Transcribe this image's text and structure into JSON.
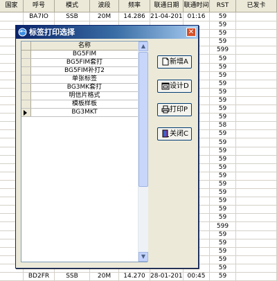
{
  "grid": {
    "columns": [
      "国家",
      "呼号",
      "模式",
      "波段",
      "频率",
      "联通日期",
      "联通时间",
      "RST",
      "已发卡"
    ],
    "rows": [
      [
        "",
        "BA7IO",
        "SSB",
        "20M",
        "14.286",
        "21-04-2012",
        "01:16",
        "59",
        ""
      ],
      [
        "",
        "",
        "",
        "",
        "",
        "",
        "",
        "59",
        ""
      ],
      [
        "",
        "",
        "",
        "",
        "",
        "",
        "",
        "59",
        ""
      ],
      [
        "",
        "",
        "",
        "",
        "",
        "",
        "",
        "59",
        ""
      ],
      [
        "",
        "",
        "",
        "",
        "",
        "",
        "",
        "599",
        ""
      ],
      [
        "",
        "",
        "",
        "",
        "",
        "",
        "",
        "59",
        ""
      ],
      [
        "",
        "",
        "",
        "",
        "",
        "",
        "",
        "59",
        ""
      ],
      [
        "",
        "",
        "",
        "",
        "",
        "",
        "",
        "59",
        ""
      ],
      [
        "",
        "",
        "",
        "",
        "",
        "",
        "",
        "59",
        ""
      ],
      [
        "",
        "",
        "",
        "",
        "",
        "",
        "",
        "59",
        ""
      ],
      [
        "",
        "",
        "",
        "",
        "",
        "",
        "",
        "59",
        ""
      ],
      [
        "",
        "",
        "",
        "",
        "",
        "",
        "",
        "59",
        ""
      ],
      [
        "",
        "",
        "",
        "",
        "",
        "",
        "",
        "59",
        ""
      ],
      [
        "",
        "",
        "",
        "",
        "",
        "",
        "",
        "58",
        ""
      ],
      [
        "",
        "",
        "",
        "",
        "",
        "",
        "",
        "59",
        ""
      ],
      [
        "",
        "",
        "",
        "",
        "",
        "",
        "",
        "59",
        ""
      ],
      [
        "",
        "",
        "",
        "",
        "",
        "",
        "",
        "59",
        ""
      ],
      [
        "",
        "",
        "",
        "",
        "",
        "",
        "",
        "59",
        ""
      ],
      [
        "",
        "",
        "",
        "",
        "",
        "",
        "",
        "59",
        ""
      ],
      [
        "",
        "",
        "",
        "",
        "",
        "",
        "",
        "59",
        ""
      ],
      [
        "",
        "",
        "",
        "",
        "",
        "",
        "",
        "59",
        ""
      ],
      [
        "",
        "",
        "",
        "",
        "",
        "",
        "",
        "59",
        ""
      ],
      [
        "",
        "",
        "",
        "",
        "",
        "",
        "",
        "59",
        ""
      ],
      [
        "",
        "",
        "",
        "",
        "",
        "",
        "",
        "59",
        ""
      ],
      [
        "",
        "",
        "",
        "",
        "",
        "",
        "",
        "59",
        ""
      ],
      [
        "",
        "",
        "",
        "",
        "",
        "",
        "",
        "599",
        ""
      ],
      [
        "",
        "",
        "",
        "",
        "",
        "",
        "",
        "59",
        ""
      ],
      [
        "",
        "",
        "",
        "",
        "",
        "",
        "",
        "59",
        ""
      ],
      [
        "",
        "",
        "",
        "",
        "",
        "",
        "",
        "59",
        ""
      ],
      [
        "",
        "",
        "",
        "",
        "",
        "",
        "",
        "59",
        ""
      ],
      [
        "",
        "",
        "",
        "",
        "",
        "",
        "",
        "59",
        ""
      ],
      [
        "",
        "BD2FR",
        "SSB",
        "20M",
        "14.270",
        "28-01-2012",
        "00:45",
        "59",
        ""
      ]
    ]
  },
  "dialog": {
    "title": "标签打印选择",
    "close_label": "✕",
    "list_header": "名称",
    "items": [
      "BG5FIM",
      "BG5FIM套打",
      "BG5FIM补打2",
      "单张标签",
      "BG3MK套打",
      "明信片格式",
      "模板样板",
      "BG3MKT"
    ],
    "current_index": 7,
    "buttons": {
      "new": "新增A",
      "design": "设计D",
      "print": "打印P",
      "close": "关闭C"
    },
    "scroll_up": "▲",
    "scroll_down": "▼"
  },
  "icons": {
    "app": "app-globe-icon",
    "new": "new-document-icon",
    "design": "design-window-icon",
    "print": "printer-icon",
    "close": "exit-door-icon"
  },
  "colors": {
    "titlebar_start": "#0a246a",
    "dialog_bg": "#ece9d8",
    "close_button": "#d4512c"
  }
}
